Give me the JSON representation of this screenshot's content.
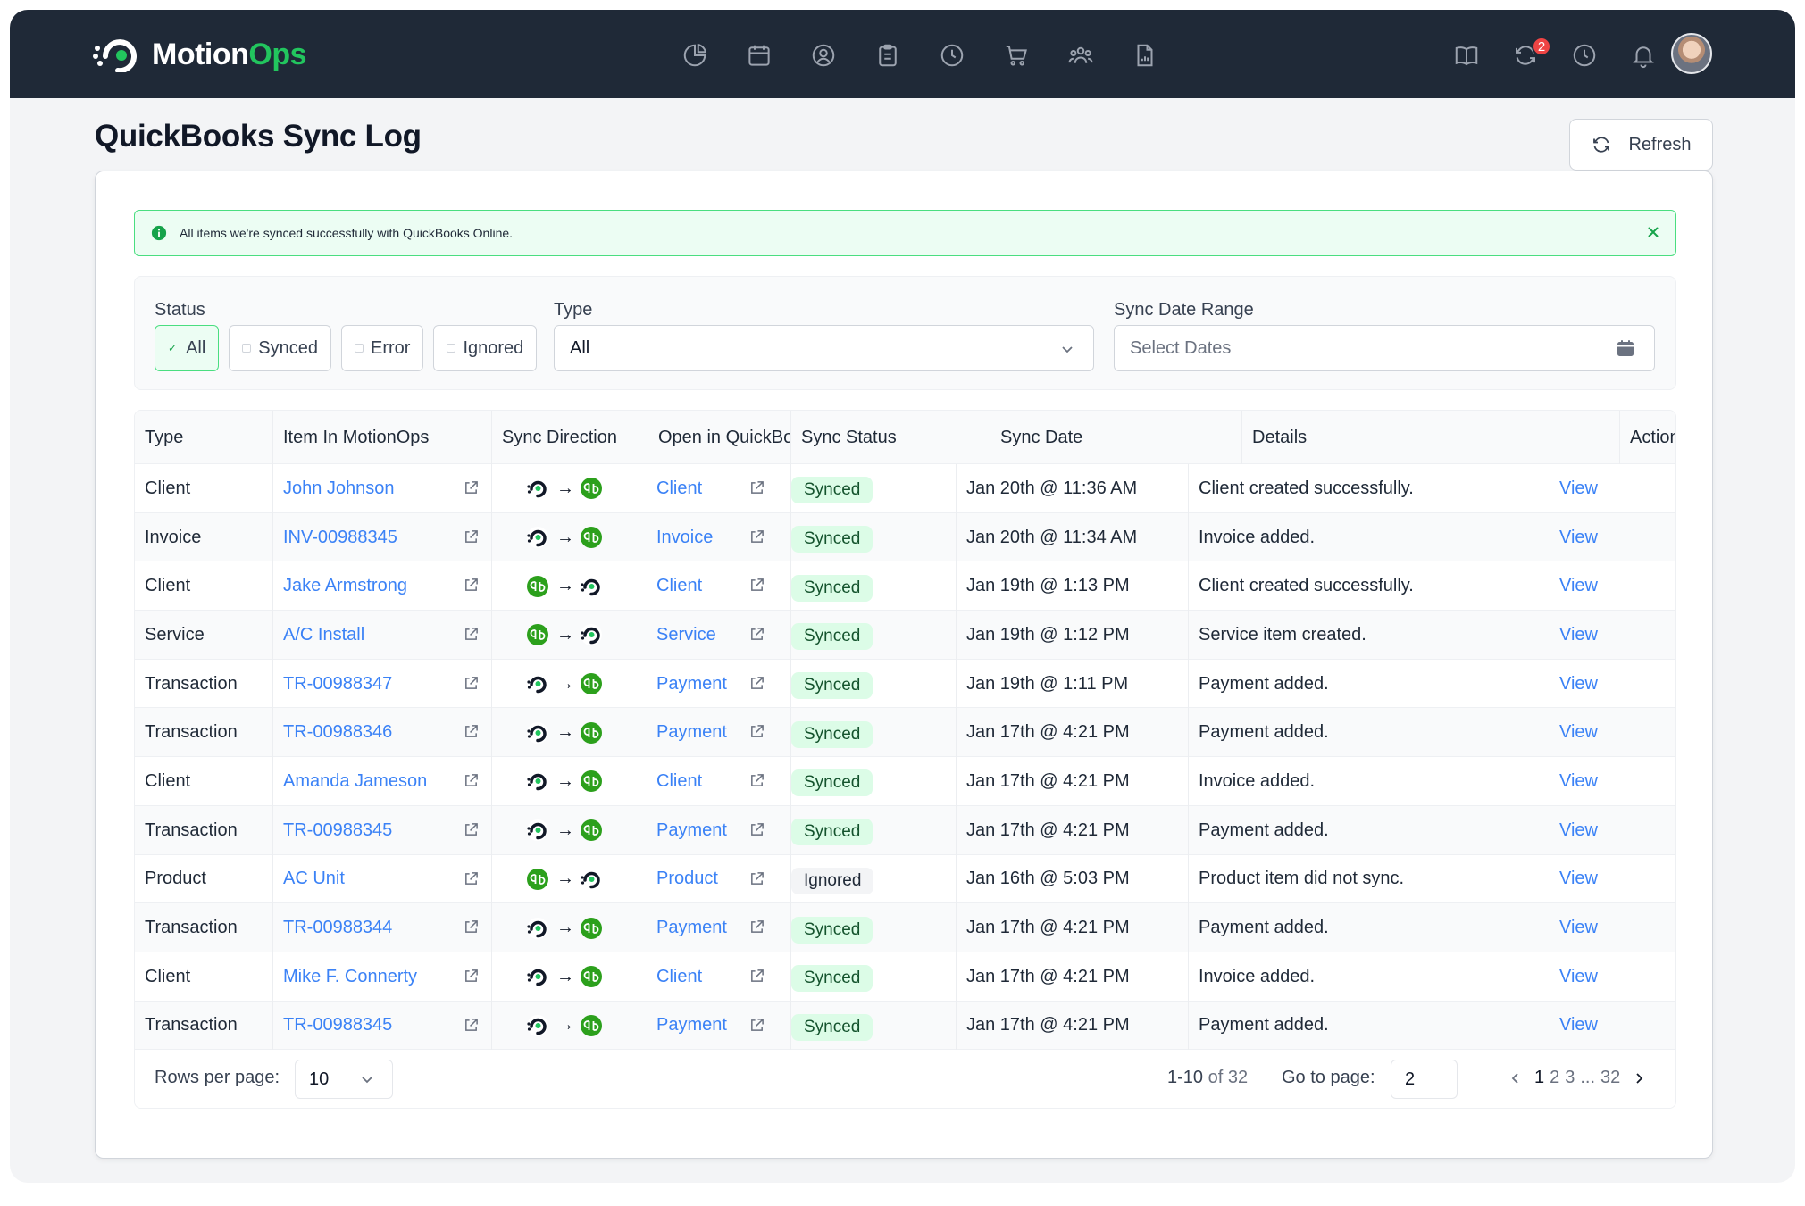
{
  "app": {
    "brand_part1": "Motion",
    "brand_part2": "Ops",
    "accent_color": "#22c55e",
    "nav_icons": [
      "pie-chart-icon",
      "calendar-icon",
      "user-circle-icon",
      "clipboard-icon",
      "clock-icon",
      "cart-icon",
      "team-icon",
      "report-icon"
    ],
    "right_icons": [
      "book-icon",
      "sync-icon",
      "history-icon",
      "bell-icon"
    ],
    "sync_badge_count": "2"
  },
  "page": {
    "title": "QuickBooks Sync Log",
    "refresh_label": "Refresh"
  },
  "alert": {
    "text": "All items we're synced successfully with QuickBooks Online."
  },
  "filters": {
    "status_label": "Status",
    "status_options": [
      "All",
      "Synced",
      "Error",
      "Ignored"
    ],
    "status_selected": "All",
    "type_label": "Type",
    "type_value": "All",
    "date_label": "Sync Date Range",
    "date_placeholder": "Select Dates"
  },
  "table": {
    "columns": [
      "Type",
      "Item In MotionOps",
      "Sync Direction",
      "Open in QuickBooks",
      "Sync Status",
      "Sync Date",
      "Details",
      "Actions"
    ],
    "rows": [
      {
        "type": "Client",
        "item": "John Johnson",
        "direction": "mo-to-qb",
        "qb": "Client",
        "status": "Synced",
        "date": "Jan 20th @ 11:36 AM",
        "details": "Client created successfully.",
        "action": "View"
      },
      {
        "type": "Invoice",
        "item": "INV-00988345",
        "direction": "mo-to-qb",
        "qb": "Invoice",
        "status": "Synced",
        "date": "Jan 20th @ 11:34 AM",
        "details": "Invoice added.",
        "action": "View"
      },
      {
        "type": "Client",
        "item": "Jake Armstrong",
        "direction": "qb-to-mo",
        "qb": "Client",
        "status": "Synced",
        "date": "Jan 19th @ 1:13 PM",
        "details": "Client created successfully.",
        "action": "View"
      },
      {
        "type": "Service",
        "item": "A/C Install",
        "direction": "qb-to-mo",
        "qb": "Service",
        "status": "Synced",
        "date": "Jan 19th @ 1:12 PM",
        "details": "Service item created.",
        "action": "View"
      },
      {
        "type": "Transaction",
        "item": "TR-00988347",
        "direction": "mo-to-qb",
        "qb": "Payment",
        "status": "Synced",
        "date": "Jan 19th @ 1:11 PM",
        "details": "Payment added.",
        "action": "View"
      },
      {
        "type": "Transaction",
        "item": "TR-00988346",
        "direction": "mo-to-qb",
        "qb": "Payment",
        "status": "Synced",
        "date": "Jan 17th @ 4:21 PM",
        "details": "Payment added.",
        "action": "View"
      },
      {
        "type": "Client",
        "item": "Amanda Jameson",
        "direction": "mo-to-qb",
        "qb": "Client",
        "status": "Synced",
        "date": "Jan 17th @ 4:21 PM",
        "details": "Invoice added.",
        "action": "View"
      },
      {
        "type": "Transaction",
        "item": "TR-00988345",
        "direction": "mo-to-qb",
        "qb": "Payment",
        "status": "Synced",
        "date": "Jan 17th @ 4:21 PM",
        "details": "Payment added.",
        "action": "View"
      },
      {
        "type": "Product",
        "item": "AC Unit",
        "direction": "qb-to-mo",
        "qb": "Product",
        "status": "Ignored",
        "date": "Jan 16th @ 5:03 PM",
        "details": "Product item did not sync.",
        "action": "View"
      },
      {
        "type": "Transaction",
        "item": "TR-00988344",
        "direction": "mo-to-qb",
        "qb": "Payment",
        "status": "Synced",
        "date": "Jan 17th @ 4:21 PM",
        "details": "Payment added.",
        "action": "View"
      },
      {
        "type": "Client",
        "item": "Mike F. Connerty",
        "direction": "mo-to-qb",
        "qb": "Client",
        "status": "Synced",
        "date": "Jan 17th @ 4:21 PM",
        "details": "Invoice added.",
        "action": "View"
      },
      {
        "type": "Transaction",
        "item": "TR-00988345",
        "direction": "mo-to-qb",
        "qb": "Payment",
        "status": "Synced",
        "date": "Jan 17th @ 4:21 PM",
        "details": "Payment added.",
        "action": "View"
      }
    ]
  },
  "pagination": {
    "rows_per_page_label": "Rows per page:",
    "rows_per_page_value": "10",
    "range": "1-10",
    "of_text": "of 32",
    "goto_label": "Go to page:",
    "goto_value": "2",
    "pages": [
      "1",
      "2",
      "3",
      "...",
      "32"
    ],
    "current_page": "1"
  }
}
